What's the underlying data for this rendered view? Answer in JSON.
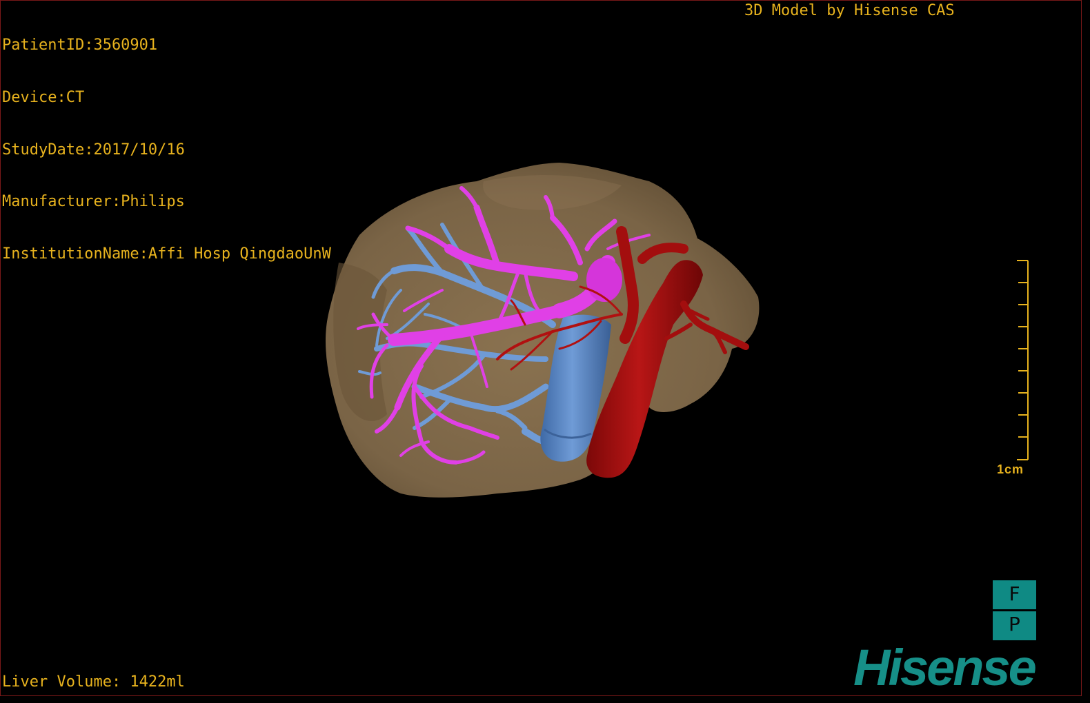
{
  "viewer": {
    "patient_id": "PatientID:3560901",
    "device": "Device:CT",
    "study_date": "StudyDate:2017/10/16",
    "manufacturer": "Manufacturer:Philips",
    "institution": "InstitutionName:Affi Hosp QingdaoUnW",
    "credit": "3D Model by Hisense CAS",
    "liver_volume": "Liver Volume: 1422ml",
    "scale_label": "1cm"
  },
  "orientation": {
    "top": "F",
    "bottom": "P"
  },
  "brand": {
    "logo_text": "Hisense"
  },
  "colors": {
    "background": "#000000",
    "overlay_text": "#e8b31e",
    "liver": "#7a6446",
    "portal_vein": "#e040e6",
    "hepatic_vein": "#6f9bd6",
    "vena_cava": "#5b86c4",
    "artery": "#b11010",
    "brand": "#168f88"
  }
}
